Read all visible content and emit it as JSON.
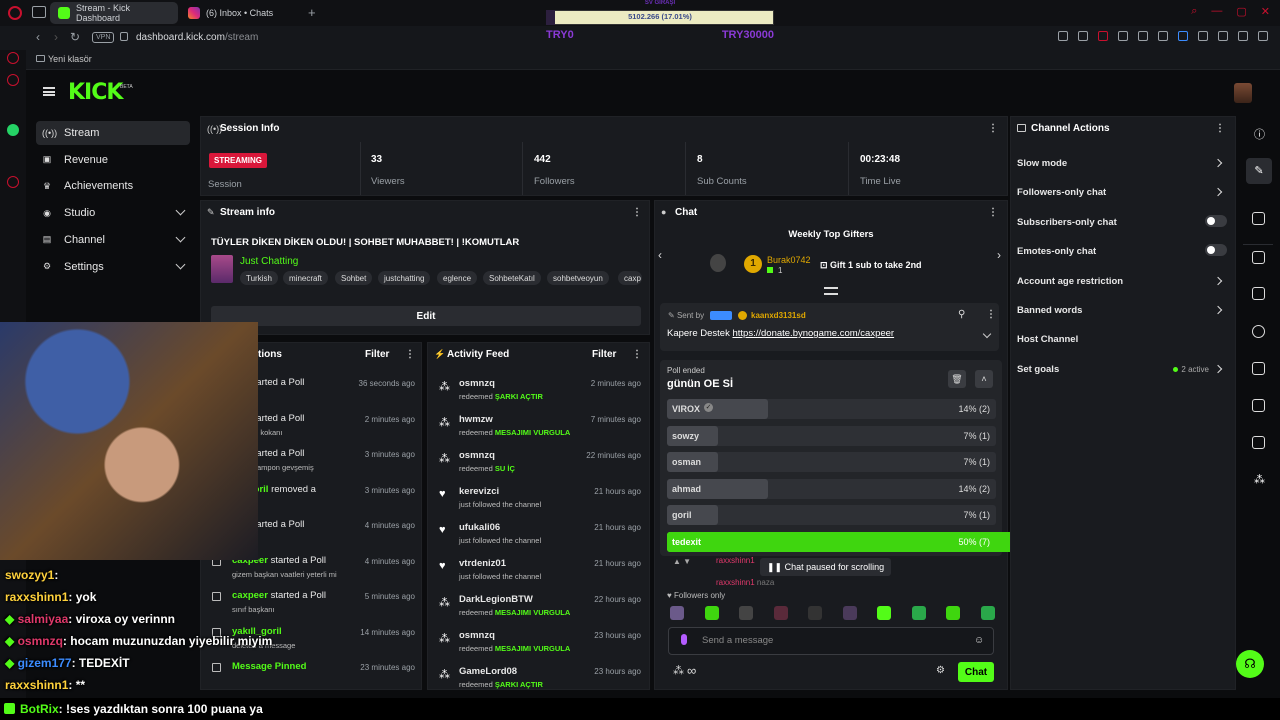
{
  "browser": {
    "tabs": [
      {
        "label": "Stream - Kick Dashboard",
        "active": true
      },
      {
        "label": "(6) Inbox • Chats",
        "active": false
      }
    ],
    "url_host": "dashboard.kick.com",
    "url_path": "/stream",
    "vpn_label": "VPN",
    "bookmark": "Yeni klasör"
  },
  "overlay": {
    "top_label": "SV GİRAŞİ",
    "progress_text": "5102.266 (17.01%)",
    "progress_fraction": 0.17,
    "left_label": "TRY0",
    "right_label": "TRY30000"
  },
  "header": {
    "logo": "KICK",
    "logo_badge": "BETA"
  },
  "nav": [
    {
      "label": "Stream",
      "icon": "broadcast-icon",
      "active": true,
      "expandable": false
    },
    {
      "label": "Revenue",
      "icon": "revenue-icon",
      "active": false,
      "expandable": false
    },
    {
      "label": "Achievements",
      "icon": "trophy-icon",
      "active": false,
      "expandable": false
    },
    {
      "label": "Studio",
      "icon": "studio-icon",
      "active": false,
      "expandable": true
    },
    {
      "label": "Channel",
      "icon": "channel-icon",
      "active": false,
      "expandable": true
    },
    {
      "label": "Settings",
      "icon": "gear-icon",
      "active": false,
      "expandable": true
    }
  ],
  "session": {
    "title": "Session Info",
    "status": "STREAMING",
    "status_label": "Session",
    "stats": [
      {
        "value": "33",
        "label": "Viewers"
      },
      {
        "value": "442",
        "label": "Followers"
      },
      {
        "value": "8",
        "label": "Sub Counts"
      },
      {
        "value": "00:23:48",
        "label": "Time Live"
      }
    ]
  },
  "stream_info": {
    "title": "Stream info",
    "stream_title": "TÜYLER DİKEN DİKEN OLDU! | SOHBET MUHABBET! | !KOMUTLAR",
    "category": "Just Chatting",
    "tags": [
      "Turkish",
      "minecraft",
      "Sohbet",
      "justchatting",
      "eglence",
      "SohbeteKatıl",
      "sohbetveoyun",
      "caxp"
    ],
    "edit_label": "Edit"
  },
  "actions_panel": {
    "title": "tions",
    "filter_label": "Filter",
    "items": [
      {
        "user": "eer",
        "action": "started a Poll",
        "detail": "OE Sİ",
        "time": "36 seconds ago"
      },
      {
        "user": "eer",
        "action": "started a Poll",
        "detail": "ayakları kokanı",
        "time": "2 minutes ago"
      },
      {
        "user": "eer",
        "action": "started a Poll",
        "detail": "n arka tampon gevşemiş",
        "time": "3 minutes ago"
      },
      {
        "user": "kli_goril",
        "action": "removed a",
        "detail": "istifa",
        "time": "3 minutes ago"
      },
      {
        "user": "eer",
        "action": "started a Poll",
        "detail": "",
        "time": "4 minutes ago"
      },
      {
        "user": "caxpeer",
        "action": "started a Poll",
        "detail": "gizem başkan vaatleri yeterli mi",
        "time": "4 minutes ago"
      },
      {
        "user": "caxpeer",
        "action": "started a Poll",
        "detail": "sınıf başkanı",
        "time": "5 minutes ago"
      },
      {
        "user": "yakıll_goril",
        "action": "",
        "detail": "deleted a message",
        "time": "14 minutes ago"
      },
      {
        "user": "Message Pinned",
        "action": "",
        "detail": "",
        "time": "23 minutes ago"
      }
    ]
  },
  "activity": {
    "title": "Activity Feed",
    "filter_label": "Filter",
    "items": [
      {
        "user": "osmnzq",
        "verb": "redeemed",
        "reward": "ŞARKI AÇTIR",
        "time": "2 minutes ago"
      },
      {
        "user": "hwmzw",
        "verb": "redeemed",
        "reward": "MESAJIMI VURGULA",
        "time": "7 minutes ago"
      },
      {
        "user": "osmnzq",
        "verb": "redeemed",
        "reward": "SU İÇ",
        "time": "22 minutes ago"
      },
      {
        "user": "kerevizci",
        "verb": "just followed the channel",
        "reward": "",
        "time": "21 hours ago"
      },
      {
        "user": "ufukali06",
        "verb": "just followed the channel",
        "reward": "",
        "time": "21 hours ago"
      },
      {
        "user": "vtrdeniz01",
        "verb": "just followed the channel",
        "reward": "",
        "time": "21 hours ago"
      },
      {
        "user": "DarkLegionBTW",
        "verb": "redeemed",
        "reward": "MESAJIMI VURGULA",
        "time": "22 hours ago"
      },
      {
        "user": "osmnzq",
        "verb": "redeemed",
        "reward": "MESAJIMI VURGULA",
        "time": "23 hours ago"
      },
      {
        "user": "GameLord08",
        "verb": "redeemed",
        "reward": "ŞARKI AÇTIR",
        "time": "23 hours ago"
      }
    ]
  },
  "chat": {
    "title": "Chat",
    "gifters_title": "Weekly Top Gifters",
    "gifter_name": "Burak0742",
    "gifter_count": "1",
    "gifter_rank": "1",
    "gift_cta": "Gift 1 sub to take 2nd",
    "pinned_by": "Sent by",
    "pinned_user": "kaanxd3131sd",
    "pinned_text": "Kapere Destek",
    "pinned_link": "https://donate.bynogame.com/caxpeer",
    "poll_status": "Poll ended",
    "poll_question": "günün OE Sİ",
    "poll_options": [
      {
        "name": "VIROX",
        "value": "14% (2)",
        "pct": 14,
        "winner": false
      },
      {
        "name": "sowzy",
        "value": "7% (1)",
        "pct": 7,
        "winner": false
      },
      {
        "name": "osman",
        "value": "7% (1)",
        "pct": 7,
        "winner": false
      },
      {
        "name": "ahmad",
        "value": "14% (2)",
        "pct": 14,
        "winner": false
      },
      {
        "name": "goril",
        "value": "7% (1)",
        "pct": 7,
        "winner": false
      },
      {
        "name": "tedexit",
        "value": "50% (7)",
        "pct": 50,
        "winner": true
      }
    ],
    "behind_user": "raxxshinn1",
    "behind_user2": "raxxshinn1",
    "behind_text": "naza",
    "paused_label": "Chat paused for scrolling",
    "followers_only": "Followers only",
    "placeholder": "Send a message",
    "send_label": "Chat",
    "infinity": "∞"
  },
  "channel_actions": {
    "title": "Channel Actions",
    "items": [
      {
        "label": "Slow mode",
        "control": "chevron"
      },
      {
        "label": "Followers-only chat",
        "control": "chevron"
      },
      {
        "label": "Subscribers-only chat",
        "control": "toggle"
      },
      {
        "label": "Emotes-only chat",
        "control": "toggle"
      },
      {
        "label": "Account age restriction",
        "control": "chevron"
      },
      {
        "label": "Banned words",
        "control": "chevron"
      },
      {
        "label": "Host Channel",
        "control": "none"
      },
      {
        "label": "Set goals",
        "control": "chevron"
      }
    ],
    "goals_active": "2 active"
  },
  "overlay_chat": [
    {
      "user": "swozyy1",
      "text": ":",
      "color": "#ffd23c"
    },
    {
      "user": "raxxshinn1",
      "text": ": yok",
      "color": "#ffd23c"
    },
    {
      "user": "salmiyaa",
      "text": ": viroxa oy verinnn",
      "color": "#e0396b"
    },
    {
      "user": "osmnzq",
      "text": ": hocam muzunuzdan yiyebilir miyim",
      "color": "#e0396b"
    },
    {
      "user": "gizem177",
      "text": ": TEDEXİT",
      "color": "#3c8cff"
    },
    {
      "user": "raxxshinn1",
      "text": ": **",
      "color": "#ffd23c"
    }
  ],
  "bottom_ticker": {
    "user": "BotRix",
    "text": ": !ses yazdıktan sonra 100 puana ya"
  },
  "colors": {
    "accent": "#53fc18",
    "live": "#d9173a",
    "panel": "#191b1f"
  }
}
